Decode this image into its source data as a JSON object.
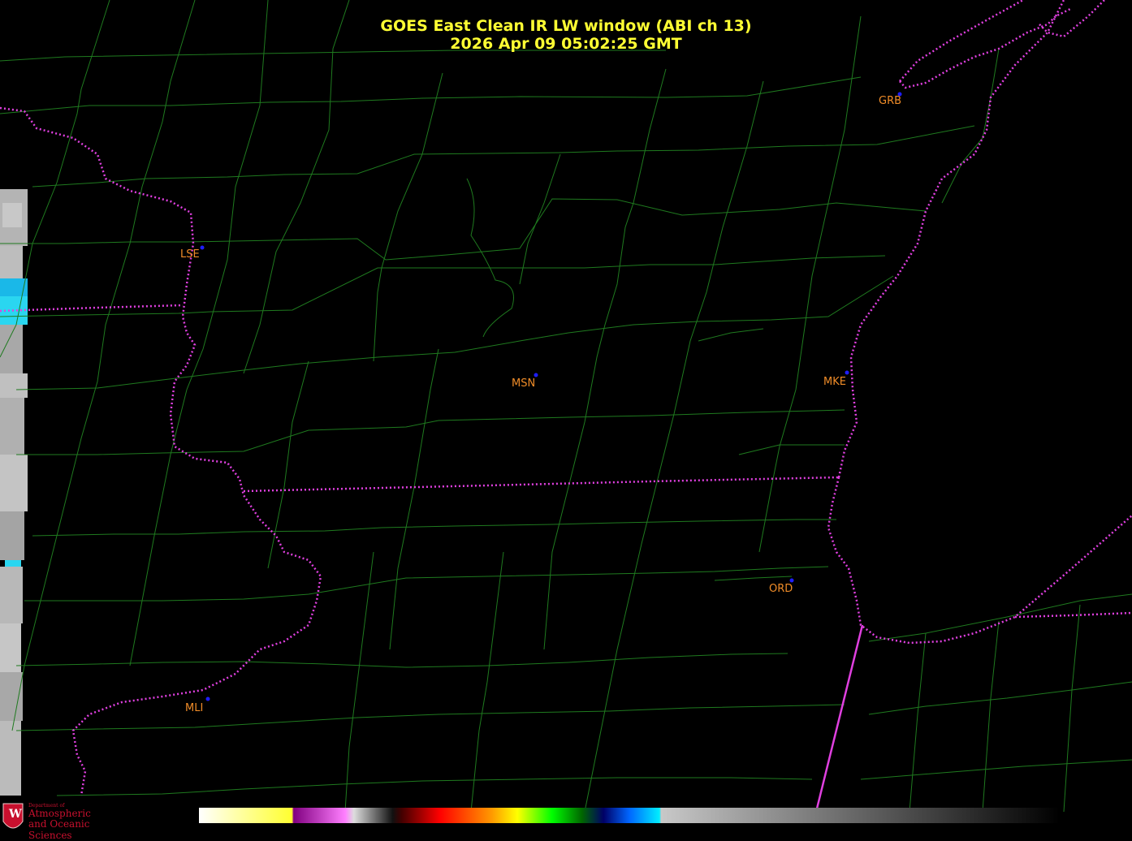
{
  "title": {
    "line1": "GOES East Clean IR LW window (ABI ch 13)",
    "line2": "2026 Apr 09  05:02:25 GMT"
  },
  "stations": [
    {
      "id": "GRB",
      "label": "GRB"
    },
    {
      "id": "LSE",
      "label": "LSE"
    },
    {
      "id": "MSN",
      "label": "MSN"
    },
    {
      "id": "MKE",
      "label": "MKE"
    },
    {
      "id": "ORD",
      "label": "ORD"
    },
    {
      "id": "MLI",
      "label": "MLI"
    }
  ],
  "logo": {
    "small": "Department of",
    "line1": "Atmospheric",
    "line2": "and Oceanic Sciences",
    "badge": "W"
  },
  "colors": {
    "title": "#ffff33",
    "station_label": "#f08c28",
    "station_dot": "#1e1eff",
    "county_line": "#1f7a1f",
    "state_line": "#e040e0",
    "logo": "#c8102e"
  }
}
